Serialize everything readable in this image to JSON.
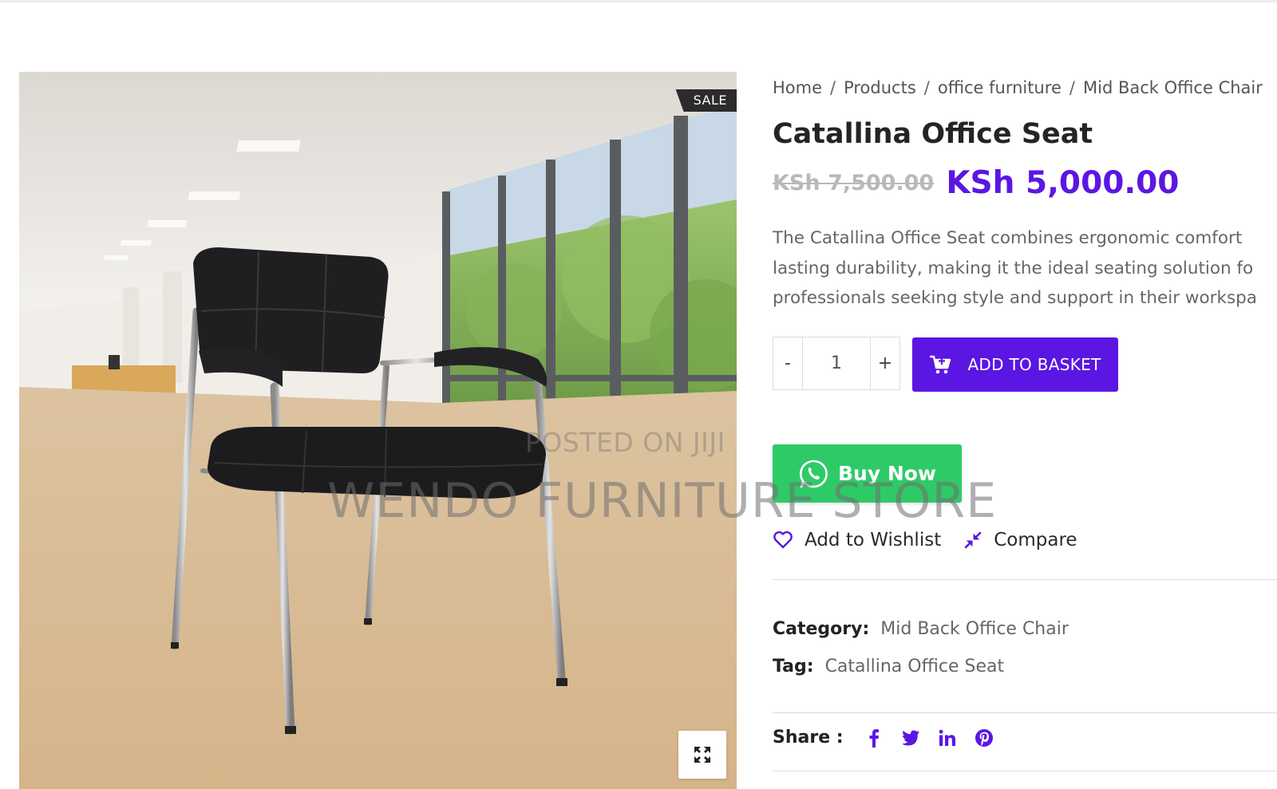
{
  "breadcrumb": {
    "items": [
      "Home",
      "Products",
      "office furniture",
      "Mid Back Office Chair"
    ],
    "separator": "/"
  },
  "product": {
    "title": "Catallina Office Seat",
    "price_old": "KSh 7,500.00",
    "price_new": "KSh 5,000.00",
    "description_lines": [
      "The Catallina Office Seat combines ergonomic comfort",
      "lasting durability, making it the ideal seating solution fo",
      "professionals seeking style and support in their workspa"
    ],
    "sale_badge": "SALE"
  },
  "quantity": {
    "minus": "-",
    "value": "1",
    "plus": "+"
  },
  "buttons": {
    "add_to_basket": "ADD TO BASKET",
    "buy_now": "Buy Now",
    "wishlist": "Add to Wishlist",
    "compare": "Compare"
  },
  "watermark": {
    "line1": "POSTED ON JIJI",
    "line2": "WENDO FURNITURE STORE"
  },
  "meta": {
    "category_label": "Category:",
    "category_value": "Mid Back Office Chair",
    "tag_label": "Tag:",
    "tag_value": "Catallina Office Seat"
  },
  "share": {
    "label": "Share :",
    "icons": [
      "facebook-icon",
      "twitter-icon",
      "linkedin-icon",
      "pinterest-icon"
    ]
  },
  "colors": {
    "accent": "#5b16e3",
    "whatsapp_green": "#2fca68",
    "sale_badge_bg": "#2b2b2b"
  }
}
